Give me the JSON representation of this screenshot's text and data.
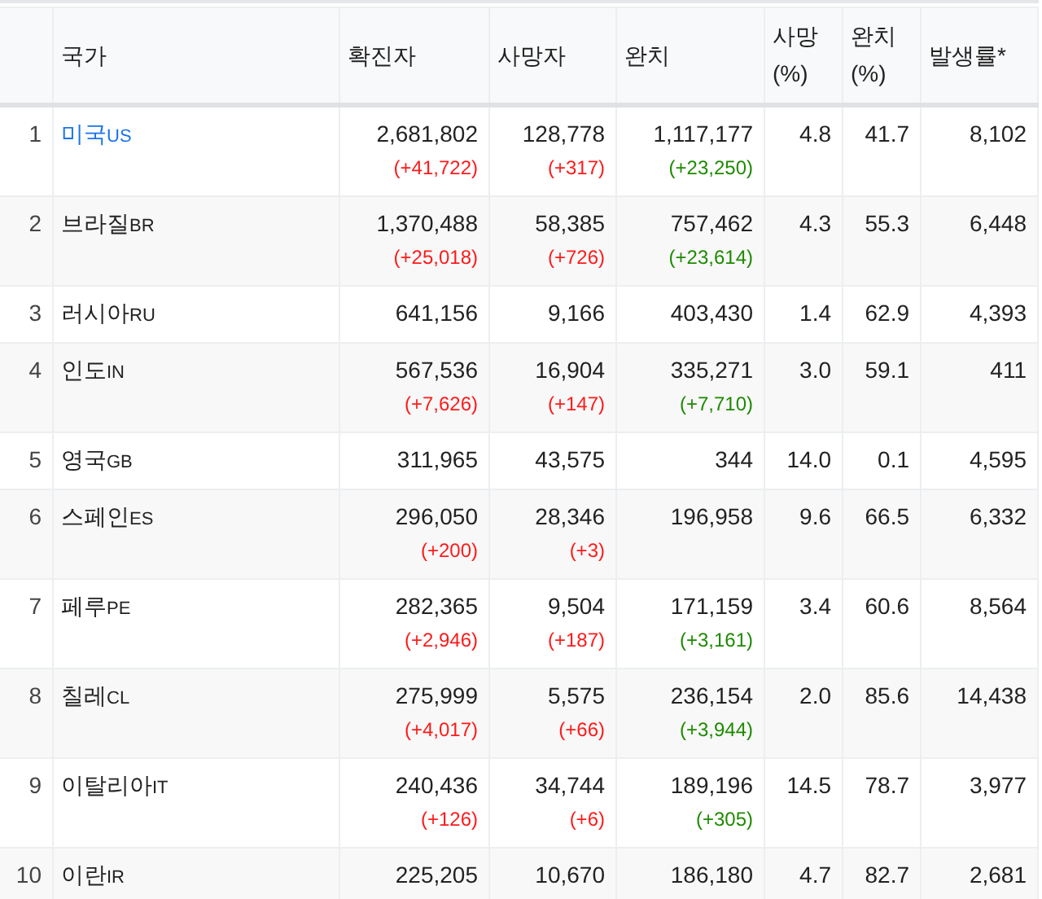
{
  "table": {
    "columns": [
      "국가",
      "확진자",
      "사망자",
      "완치",
      "사망 (%)",
      "완치 (%)",
      "발생률*"
    ],
    "rows": [
      {
        "rank": "1",
        "country": "미국",
        "code": "US",
        "link": true,
        "confirmed": "2,681,802",
        "confirmed_delta": "(+41,722)",
        "deaths": "128,778",
        "deaths_delta": "(+317)",
        "recovered": "1,117,177",
        "recovered_delta": "(+23,250)",
        "death_rate": "4.8",
        "recovery_rate": "41.7",
        "incidence": "8,102"
      },
      {
        "rank": "2",
        "country": "브라질",
        "code": "BR",
        "link": false,
        "confirmed": "1,370,488",
        "confirmed_delta": "(+25,018)",
        "deaths": "58,385",
        "deaths_delta": "(+726)",
        "recovered": "757,462",
        "recovered_delta": "(+23,614)",
        "death_rate": "4.3",
        "recovery_rate": "55.3",
        "incidence": "6,448"
      },
      {
        "rank": "3",
        "country": "러시아",
        "code": "RU",
        "link": false,
        "confirmed": "641,156",
        "deaths": "9,166",
        "recovered": "403,430",
        "death_rate": "1.4",
        "recovery_rate": "62.9",
        "incidence": "4,393"
      },
      {
        "rank": "4",
        "country": "인도",
        "code": "IN",
        "link": false,
        "confirmed": "567,536",
        "confirmed_delta": "(+7,626)",
        "deaths": "16,904",
        "deaths_delta": "(+147)",
        "recovered": "335,271",
        "recovered_delta": "(+7,710)",
        "death_rate": "3.0",
        "recovery_rate": "59.1",
        "incidence": "411"
      },
      {
        "rank": "5",
        "country": "영국",
        "code": "GB",
        "link": false,
        "confirmed": "311,965",
        "deaths": "43,575",
        "recovered": "344",
        "death_rate": "14.0",
        "recovery_rate": "0.1",
        "incidence": "4,595"
      },
      {
        "rank": "6",
        "country": "스페인",
        "code": "ES",
        "link": false,
        "confirmed": "296,050",
        "confirmed_delta": "(+200)",
        "deaths": "28,346",
        "deaths_delta": "(+3)",
        "recovered": "196,958",
        "death_rate": "9.6",
        "recovery_rate": "66.5",
        "incidence": "6,332"
      },
      {
        "rank": "7",
        "country": "페루",
        "code": "PE",
        "link": false,
        "confirmed": "282,365",
        "confirmed_delta": "(+2,946)",
        "deaths": "9,504",
        "deaths_delta": "(+187)",
        "recovered": "171,159",
        "recovered_delta": "(+3,161)",
        "death_rate": "3.4",
        "recovery_rate": "60.6",
        "incidence": "8,564"
      },
      {
        "rank": "8",
        "country": "칠레",
        "code": "CL",
        "link": false,
        "confirmed": "275,999",
        "confirmed_delta": "(+4,017)",
        "deaths": "5,575",
        "deaths_delta": "(+66)",
        "recovered": "236,154",
        "recovered_delta": "(+3,944)",
        "death_rate": "2.0",
        "recovery_rate": "85.6",
        "incidence": "14,438"
      },
      {
        "rank": "9",
        "country": "이탈리아",
        "code": "IT",
        "link": false,
        "confirmed": "240,436",
        "confirmed_delta": "(+126)",
        "deaths": "34,744",
        "deaths_delta": "(+6)",
        "recovered": "189,196",
        "recovered_delta": "(+305)",
        "death_rate": "14.5",
        "recovery_rate": "78.7",
        "incidence": "3,977"
      },
      {
        "rank": "10",
        "country": "이란",
        "code": "IR",
        "link": false,
        "confirmed": "225,205",
        "deaths": "10,670",
        "recovered": "186,180",
        "death_rate": "4.7",
        "recovery_rate": "82.7",
        "incidence": "2,681"
      }
    ]
  }
}
